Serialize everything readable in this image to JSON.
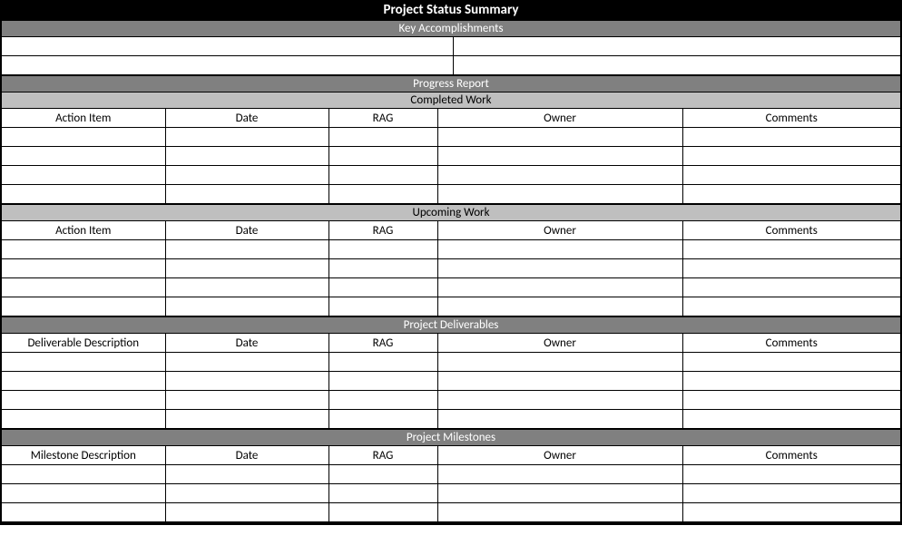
{
  "title": "Project Status Summary",
  "sections": {
    "key_accomplishments": {
      "label": "Key Accomplishments"
    },
    "progress_report": {
      "label": "Progress Report"
    },
    "completed_work": {
      "label": "Completed Work",
      "headers": {
        "c0": "Action Item",
        "c1": "Date",
        "c2": "RAG",
        "c3": "Owner",
        "c4": "Comments"
      }
    },
    "upcoming_work": {
      "label": "Upcoming Work",
      "headers": {
        "c0": "Action Item",
        "c1": "Date",
        "c2": "RAG",
        "c3": "Owner",
        "c4": "Comments"
      }
    },
    "deliverables": {
      "label": "Project Deliverables",
      "headers": {
        "c0": "Deliverable Description",
        "c1": "Date",
        "c2": "RAG",
        "c3": "Owner",
        "c4": "Comments"
      }
    },
    "milestones": {
      "label": "Project Milestones",
      "headers": {
        "c0": "Milestone Description",
        "c1": "Date",
        "c2": "RAG",
        "c3": "Owner",
        "c4": "Comments"
      }
    }
  }
}
